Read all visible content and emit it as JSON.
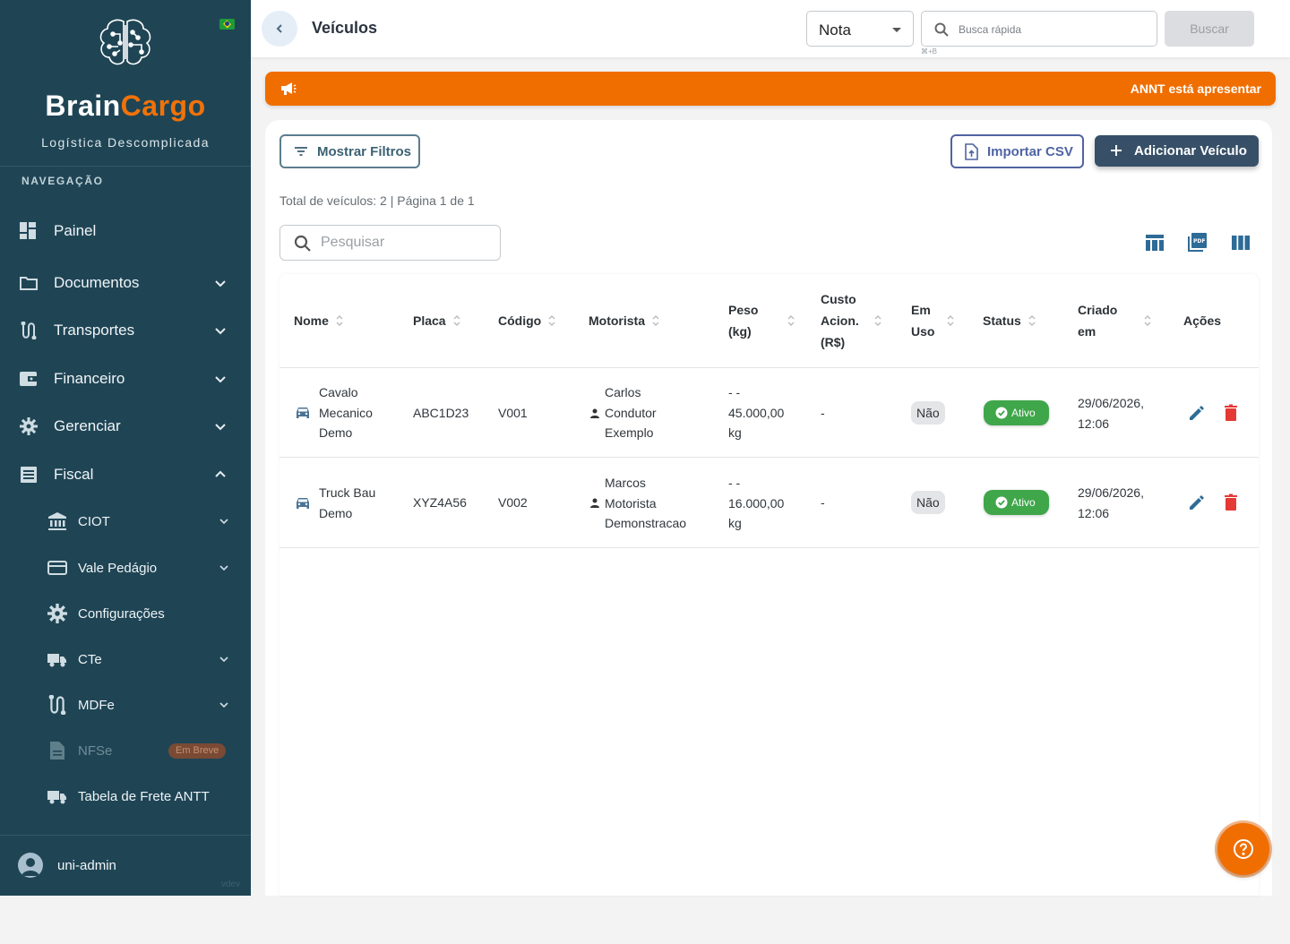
{
  "app": {
    "brand_part1": "Brain",
    "brand_part2": "Cargo",
    "tagline": "Logística Descomplicada",
    "colors": {
      "sidebar": "#1f4555",
      "accent": "#f06e00",
      "primary": "#375068",
      "success": "#3fa64a",
      "danger": "#e53935"
    }
  },
  "sidebar": {
    "heading": "NAVEGAÇÃO",
    "items": [
      {
        "label": "Painel",
        "icon": "dashboard-icon"
      },
      {
        "label": "Documentos",
        "icon": "folder-icon"
      },
      {
        "label": "Transportes",
        "icon": "route-icon"
      },
      {
        "label": "Financeiro",
        "icon": "wallet-icon"
      },
      {
        "label": "Gerenciar",
        "icon": "gear-icon"
      },
      {
        "label": "Fiscal",
        "icon": "receipt-icon"
      }
    ],
    "fiscal_items": [
      {
        "label": "CIOT",
        "icon": "bank-icon"
      },
      {
        "label": "Vale Pedágio",
        "icon": "card-icon"
      },
      {
        "label": "Configurações",
        "icon": "gear-icon"
      },
      {
        "label": "CTe",
        "icon": "truck-icon"
      },
      {
        "label": "MDFe",
        "icon": "route-icon"
      },
      {
        "label": "NFSe",
        "icon": "document-icon",
        "badge": "Em Breve"
      },
      {
        "label": "Tabela de Frete ANTT",
        "icon": "truck-icon"
      }
    ],
    "user": "uni-admin",
    "version": "vdev"
  },
  "header": {
    "title": "Veículos",
    "select_value": "Nota",
    "search_placeholder": "Busca rápida",
    "shortcut": "⌘+B",
    "search_button": "Buscar"
  },
  "banner": {
    "text": "ANNT está apresentar"
  },
  "toolbar": {
    "filters_label": "Mostrar Filtros",
    "import_label": "Importar CSV",
    "add_label": "Adicionar Veículo",
    "total_text": "Total de veículos: 2 | Página 1 de 1",
    "search_placeholder": "Pesquisar"
  },
  "table": {
    "headers": {
      "nome": "Nome",
      "placa": "Placa",
      "codigo": "Código",
      "motorista": "Motorista",
      "peso_l1": "Peso",
      "peso_l2": "(kg)",
      "custo_l1": "Custo",
      "custo_l2": "Acion.",
      "custo_l3": "(R$)",
      "uso_l1": "Em",
      "uso_l2": "Uso",
      "status": "Status",
      "criado_l1": "Criado",
      "criado_l2": "em",
      "acoes": "Ações"
    },
    "rows": [
      {
        "nome": [
          "Cavalo",
          "Mecanico",
          "Demo"
        ],
        "placa": "ABC1D23",
        "codigo": "V001",
        "motorista": [
          "Carlos",
          "Condutor",
          "Exemplo"
        ],
        "peso": [
          "- -",
          "45.000,00",
          "kg"
        ],
        "custo": "-",
        "em_uso": "Não",
        "status": "Ativo",
        "criado": [
          "29/06/2026,",
          "12:06"
        ]
      },
      {
        "nome": [
          "Truck Bau",
          "Demo"
        ],
        "placa": "XYZ4A56",
        "codigo": "V002",
        "motorista": [
          "Marcos",
          "Motorista",
          "Demonstracao"
        ],
        "peso": [
          "- -",
          "16.000,00",
          "kg"
        ],
        "custo": "-",
        "em_uso": "Não",
        "status": "Ativo",
        "criado": [
          "29/06/2026,",
          "12:06"
        ]
      }
    ]
  }
}
